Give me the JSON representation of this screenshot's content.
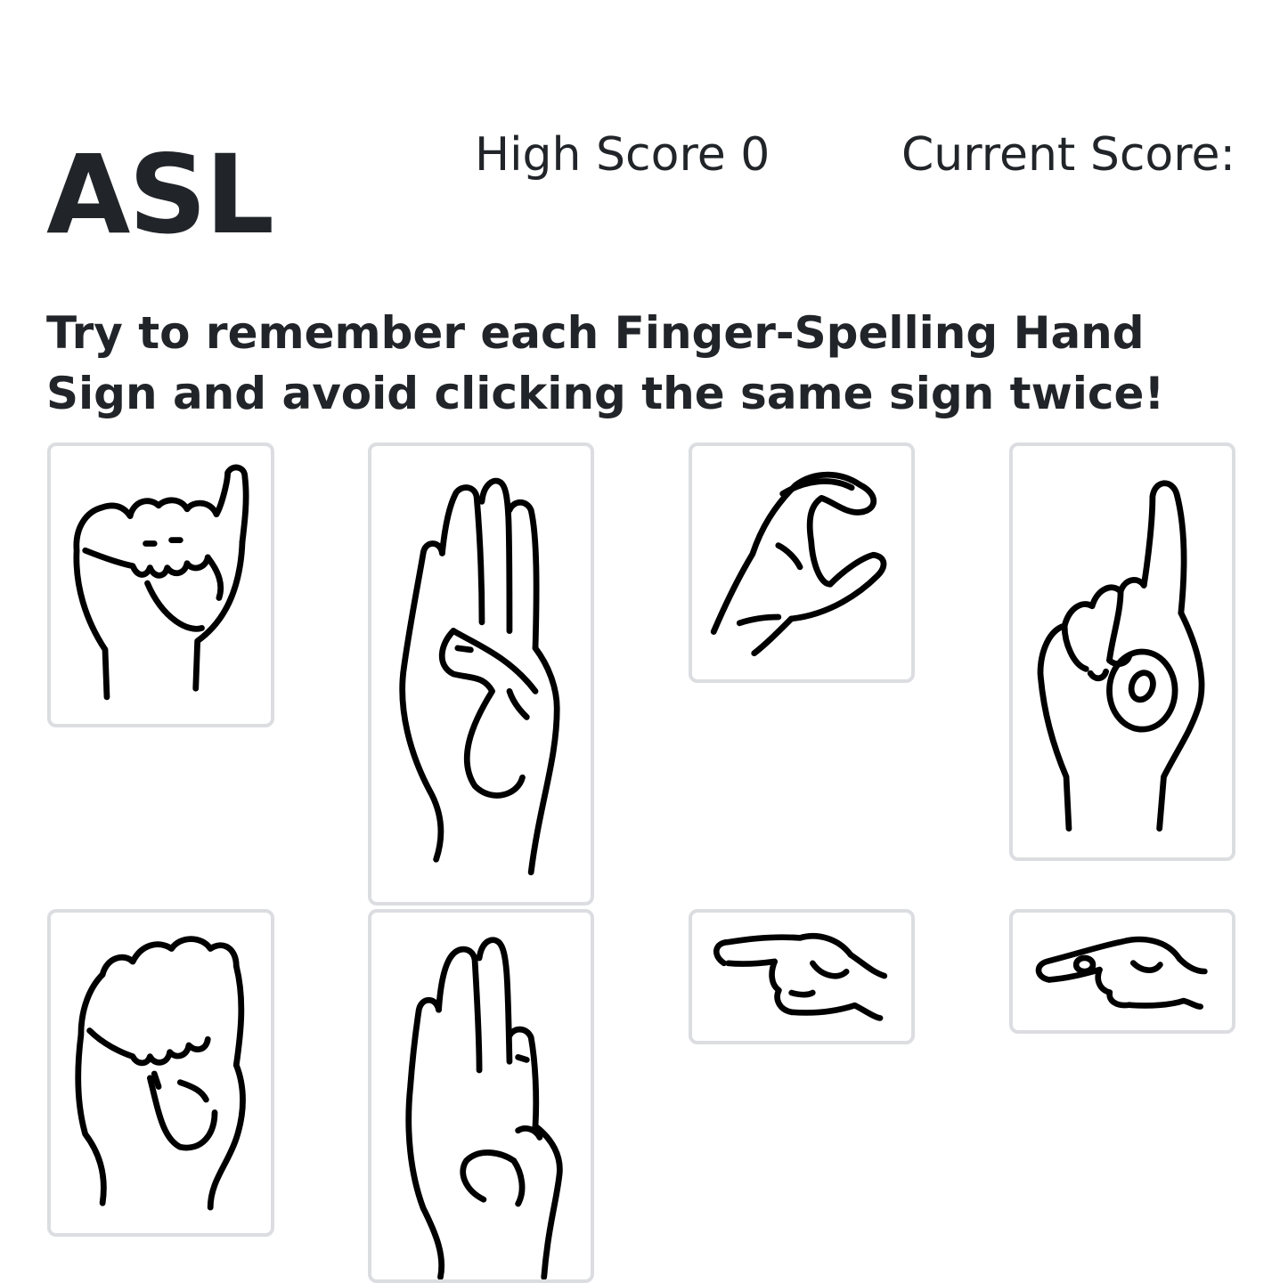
{
  "header": {
    "title": "ASL",
    "high_score_label": "High Score 0",
    "current_score_label": "Current Score:"
  },
  "instructions": "Try to remember each Finger-Spelling Hand Sign and avoid clicking the same sign twice!",
  "cards": [
    {
      "icon": "hand-sign-a-icon"
    },
    {
      "icon": "hand-sign-b-icon"
    },
    {
      "icon": "hand-sign-c-icon"
    },
    {
      "icon": "hand-sign-d-icon"
    },
    {
      "icon": "hand-sign-e-icon"
    },
    {
      "icon": "hand-sign-f-icon"
    },
    {
      "icon": "hand-sign-g-icon"
    },
    {
      "icon": "hand-sign-h-icon"
    }
  ],
  "colors": {
    "text": "#212529",
    "card_border": "#dcdde1",
    "background": "#ffffff"
  }
}
